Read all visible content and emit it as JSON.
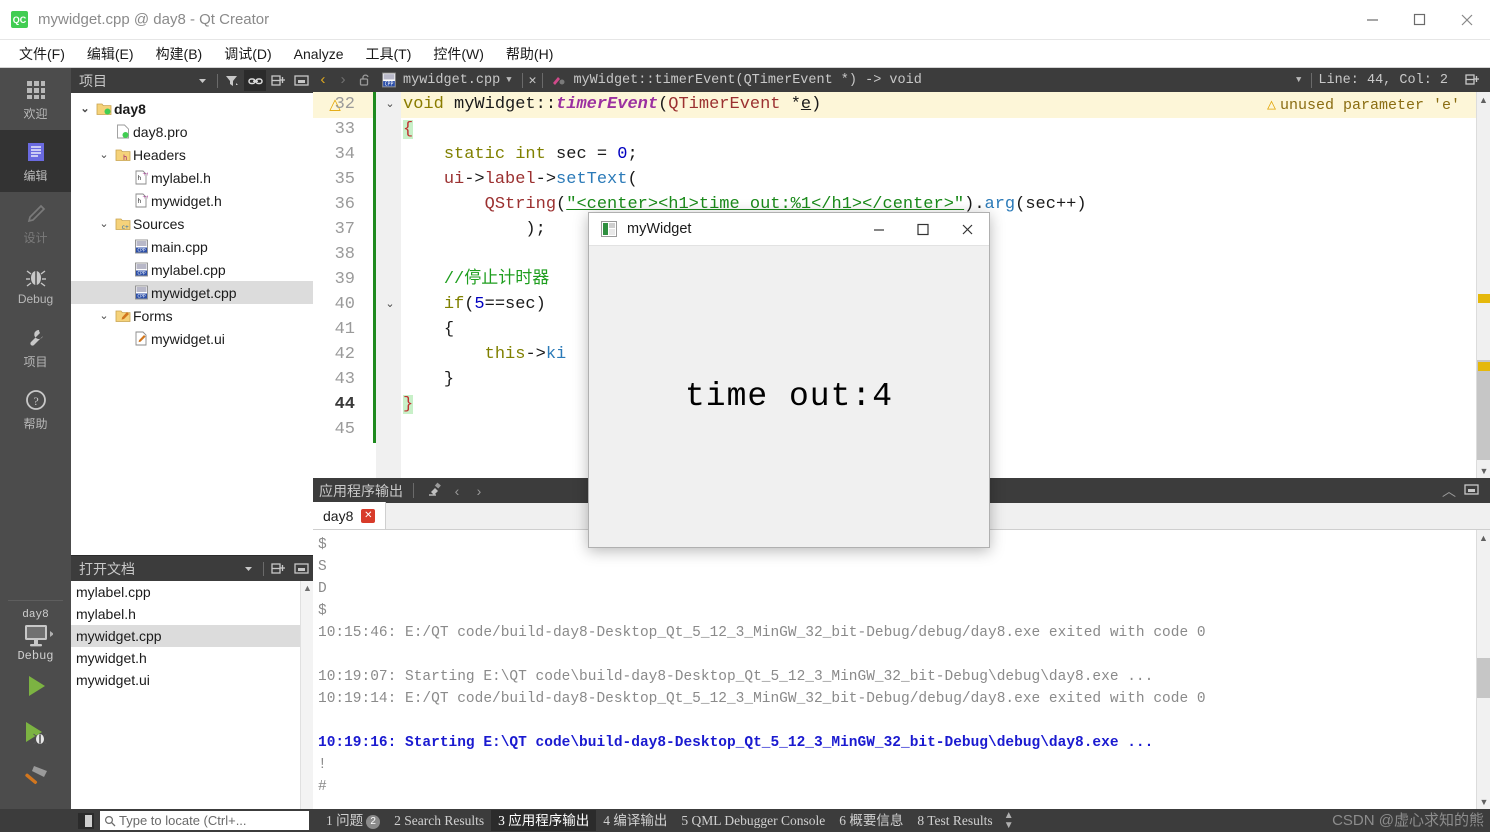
{
  "window": {
    "title": "mywidget.cpp @ day8 - Qt Creator",
    "app_icon_text": "QC",
    "minimize": "—",
    "maximize": "□",
    "close": "✕"
  },
  "menubar": {
    "items": [
      {
        "label": "文件(F)",
        "mnemonic": "F"
      },
      {
        "label": "编辑(E)",
        "mnemonic": "E"
      },
      {
        "label": "构建(B)",
        "mnemonic": "B"
      },
      {
        "label": "调试(D)",
        "mnemonic": "D"
      },
      {
        "label": "Analyze",
        "mnemonic": "A"
      },
      {
        "label": "工具(T)",
        "mnemonic": "T"
      },
      {
        "label": "控件(W)",
        "mnemonic": "W"
      },
      {
        "label": "帮助(H)",
        "mnemonic": "H"
      }
    ]
  },
  "activity_bar": {
    "items": [
      {
        "label": "欢迎",
        "icon": "grid-icon",
        "active": false,
        "dim": false
      },
      {
        "label": "编辑",
        "icon": "document-icon",
        "active": true,
        "dim": false
      },
      {
        "label": "设计",
        "icon": "pencil-icon",
        "active": false,
        "dim": true
      },
      {
        "label": "Debug",
        "icon": "bug-icon",
        "active": false,
        "dim": false
      },
      {
        "label": "项目",
        "icon": "wrench-icon",
        "active": false,
        "dim": false
      },
      {
        "label": "帮助",
        "icon": "question-icon",
        "active": false,
        "dim": false
      }
    ],
    "kit": {
      "project": "day8",
      "mode": "Debug",
      "run_label": "run-button",
      "debug_label": "run-debug-button",
      "build_label": "build-button"
    }
  },
  "project_panel": {
    "title": "项目",
    "toolbar": [
      "filter-icon",
      "link-icon",
      "split-icon",
      "close-panel-icon"
    ],
    "tree": [
      {
        "label": "day8",
        "depth": 0,
        "chev": "v",
        "icon": "qt-folder-icon",
        "bold": true,
        "selected": false
      },
      {
        "label": "day8.pro",
        "depth": 1,
        "chev": "",
        "icon": "pro-file-icon",
        "bold": false,
        "selected": false
      },
      {
        "label": "Headers",
        "depth": 1,
        "chev": "v",
        "icon": "folder-h-icon",
        "bold": false,
        "selected": false
      },
      {
        "label": "mylabel.h",
        "depth": 2,
        "chev": "",
        "icon": "header-file-icon",
        "bold": false,
        "selected": false
      },
      {
        "label": "mywidget.h",
        "depth": 2,
        "chev": "",
        "icon": "header-file-icon",
        "bold": false,
        "selected": false
      },
      {
        "label": "Sources",
        "depth": 1,
        "chev": "v",
        "icon": "folder-cpp-icon",
        "bold": false,
        "selected": false
      },
      {
        "label": "main.cpp",
        "depth": 2,
        "chev": "",
        "icon": "cpp-file-icon",
        "bold": false,
        "selected": false
      },
      {
        "label": "mylabel.cpp",
        "depth": 2,
        "chev": "",
        "icon": "cpp-file-icon",
        "bold": false,
        "selected": false
      },
      {
        "label": "mywidget.cpp",
        "depth": 2,
        "chev": "",
        "icon": "cpp-file-icon",
        "bold": false,
        "selected": true
      },
      {
        "label": "Forms",
        "depth": 1,
        "chev": "v",
        "icon": "folder-ui-icon",
        "bold": false,
        "selected": false
      },
      {
        "label": "mywidget.ui",
        "depth": 2,
        "chev": "",
        "icon": "ui-file-icon",
        "bold": false,
        "selected": false
      }
    ]
  },
  "open_documents": {
    "title": "打开文档",
    "files": [
      {
        "label": "mylabel.cpp",
        "selected": false
      },
      {
        "label": "mylabel.h",
        "selected": false
      },
      {
        "label": "mywidget.cpp",
        "selected": true
      },
      {
        "label": "mywidget.h",
        "selected": false
      },
      {
        "label": "mywidget.ui",
        "selected": false
      }
    ]
  },
  "editor": {
    "toolbar": {
      "back": "‹",
      "forward": "›",
      "lock_icon": "unlock-icon",
      "file_icon": "cpp-file-icon",
      "filename": "mywidget.cpp",
      "symbol": "myWidget::timerEvent(QTimerEvent *) -> void",
      "position": "Line: 44, Col: 2",
      "split_icon": "split-editor-icon"
    },
    "warning": {
      "text": "unused parameter 'e'",
      "icon": "warning-triangle-icon"
    },
    "lines": [
      {
        "no": "32",
        "warn": true,
        "fold": "v",
        "current": false,
        "html": "<span class='k-type'>void</span> <span class='k-class'>myWidget</span><span class='k-plain'>::</span><span class='k-fn'>timerEvent</span><span class='k-plain'>(</span><span class='k-member'>QTimerEvent</span> <span class='k-plain'>*</span><span class='k-param'>e</span><span class='k-plain'>)</span>"
      },
      {
        "no": "33",
        "warn": false,
        "fold": "",
        "current": false,
        "html": "<span class='k-brace-hl'>{</span>"
      },
      {
        "no": "34",
        "warn": false,
        "fold": "",
        "current": false,
        "html": "    <span class='k-kw'>static</span> <span class='k-kw'>int</span> <span class='k-var'>sec</span> <span class='k-plain'>=</span> <span class='k-num'>0</span><span class='k-plain'>;</span>"
      },
      {
        "no": "35",
        "warn": false,
        "fold": "",
        "current": false,
        "html": "    <span class='k-member'>ui</span><span class='k-plain'>-&gt;</span><span class='k-member'>label</span><span class='k-plain'>-&gt;</span><span class='k-call'>setText</span><span class='k-plain'>(</span>"
      },
      {
        "no": "36",
        "warn": false,
        "fold": "",
        "current": false,
        "html": "        <span class='k-member'>QString</span><span class='k-plain'>(</span><span class='k-str'>\"&lt;center&gt;&lt;h1&gt;time out:%1&lt;/h1&gt;&lt;/center&gt;\"</span><span class='k-plain'>).</span><span class='k-call'>arg</span><span class='k-plain'>(</span><span class='k-var'>sec</span><span class='k-plain'>++)</span>"
      },
      {
        "no": "37",
        "warn": false,
        "fold": "",
        "current": false,
        "html": "            <span class='k-plain'>);</span>"
      },
      {
        "no": "38",
        "warn": false,
        "fold": "",
        "current": false,
        "html": ""
      },
      {
        "no": "39",
        "warn": false,
        "fold": "",
        "current": false,
        "html": "    <span class='k-cmt'>//停止计时器</span>"
      },
      {
        "no": "40",
        "warn": false,
        "fold": "v",
        "current": false,
        "html": "    <span class='k-kw'>if</span><span class='k-plain'>(</span><span class='k-num'>5</span><span class='k-plain'>==</span><span class='k-var'>sec</span><span class='k-plain'>)</span>"
      },
      {
        "no": "41",
        "warn": false,
        "fold": "",
        "current": false,
        "html": "    <span class='k-plain'>{</span>"
      },
      {
        "no": "42",
        "warn": false,
        "fold": "",
        "current": false,
        "html": "        <span class='k-kw'>this</span><span class='k-plain'>-&gt;</span><span class='k-call'>ki</span>"
      },
      {
        "no": "43",
        "warn": false,
        "fold": "",
        "current": false,
        "html": "    <span class='k-plain'>}</span>"
      },
      {
        "no": "44",
        "warn": false,
        "fold": "",
        "current": true,
        "html": "<span class='k-brace-hl'>}</span>"
      },
      {
        "no": "45",
        "warn": false,
        "fold": "",
        "current": false,
        "html": ""
      }
    ]
  },
  "output_pane": {
    "title": "应用程序输出",
    "toolbar_icons": [
      "clear-output-icon",
      "prev-item-icon",
      "next-item-icon"
    ],
    "right_icons": [
      "collapse-icon",
      "maximize-pane-icon"
    ],
    "tab": {
      "label": "day8",
      "close": "✕"
    },
    "lines": [
      {
        "text": "$",
        "blue": false
      },
      {
        "text": "S",
        "blue": false
      },
      {
        "text": "D",
        "blue": false
      },
      {
        "text": "$",
        "blue": false
      },
      {
        "text": "10:15:46: E:/QT code/build-day8-Desktop_Qt_5_12_3_MinGW_32_bit-Debug/debug/day8.exe exited with code 0",
        "blue": false
      },
      {
        "text": "",
        "blue": false
      },
      {
        "text": "10:19:07: Starting E:\\QT code\\build-day8-Desktop_Qt_5_12_3_MinGW_32_bit-Debug\\debug\\day8.exe ...",
        "blue": false
      },
      {
        "text": "10:19:14: E:/QT code/build-day8-Desktop_Qt_5_12_3_MinGW_32_bit-Debug/debug/day8.exe exited with code 0",
        "blue": false
      },
      {
        "text": "",
        "blue": false
      },
      {
        "text": "10:19:16: Starting E:\\QT code\\build-day8-Desktop_Qt_5_12_3_MinGW_32_bit-Debug\\debug\\day8.exe ...",
        "blue": true
      },
      {
        "text": "!",
        "blue": false
      },
      {
        "text": "#",
        "blue": false
      }
    ]
  },
  "mywidget_window": {
    "title": "myWidget",
    "label_text": "time out:4",
    "minimize": "—",
    "maximize": "□",
    "close": "✕"
  },
  "statusbar": {
    "locator_placeholder": "Type to locate (Ctrl+...",
    "search_icon": "search-icon",
    "tabs": [
      {
        "num": "1",
        "label": "问题",
        "badge": "2",
        "active": false
      },
      {
        "num": "2",
        "label": "Search Results",
        "badge": "",
        "active": false
      },
      {
        "num": "3",
        "label": "应用程序输出",
        "badge": "",
        "active": true
      },
      {
        "num": "4",
        "label": "编译输出",
        "badge": "",
        "active": false
      },
      {
        "num": "5",
        "label": "QML Debugger Console",
        "badge": "",
        "active": false
      },
      {
        "num": "6",
        "label": "概要信息",
        "badge": "",
        "active": false
      },
      {
        "num": "8",
        "label": "Test Results",
        "badge": "",
        "active": false
      }
    ],
    "watermark": "CSDN @虚心求知的熊"
  },
  "colors": {
    "accent_green": "#41cd52",
    "chrome_dark": "#3c3c3c",
    "activity_bar": "#4c4c4c",
    "selection": "#dcdcdc",
    "warning": "#e2a400",
    "warning_bg": "#fdf6d8",
    "blue_text": "#1a1ad0",
    "run_green": "#7cb342"
  }
}
